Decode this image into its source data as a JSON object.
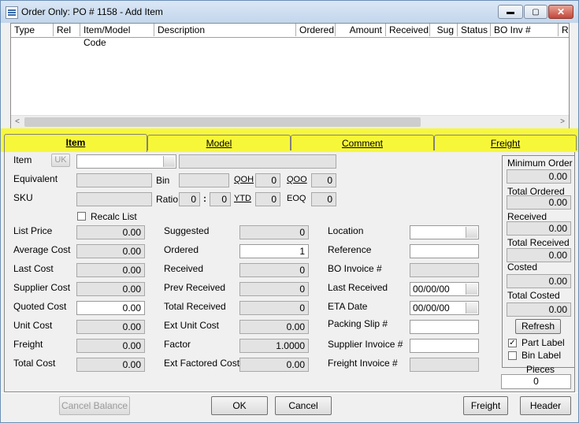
{
  "window": {
    "title": "Order Only: PO # 1158  - Add Item",
    "minimize": "▬",
    "maximize": "▢",
    "close": "✕"
  },
  "grid": {
    "columns": [
      "Type",
      "Rel",
      "Item/Model Code",
      "Description",
      "Ordered",
      "Amount",
      "Received",
      "Sug",
      "Status",
      "BO Inv #",
      "R"
    ],
    "scroll_left": "<",
    "scroll_right": ">"
  },
  "tabs": [
    {
      "label": "Item",
      "active": true
    },
    {
      "label": "Model",
      "active": false
    },
    {
      "label": "Comment",
      "active": false
    },
    {
      "label": "Freight",
      "active": false
    }
  ],
  "top": {
    "item_label": "Item",
    "uk_button": "UK",
    "item_value": "",
    "item_desc": "",
    "equivalent_label": "Equivalent",
    "equivalent_value": "",
    "bin_label": "Bin",
    "bin_value": "",
    "qoh_label": "QOH",
    "qoh_value": "0",
    "qoo_label": "QOO",
    "qoo_value": "0",
    "sku_label": "SKU",
    "sku_value": "",
    "ratio_label": "Ratio",
    "ratio_a": "0",
    "ratio_sep": ":",
    "ratio_b": "0",
    "ytd_label": "YTD",
    "ytd_value": "0",
    "eoq_label": "EOQ",
    "eoq_value": "0",
    "recalc_label": "Recalc List"
  },
  "col1": [
    {
      "label": "List Price",
      "value": "0.00",
      "editable": false
    },
    {
      "label": "Average Cost",
      "value": "0.00",
      "editable": false
    },
    {
      "label": "Last Cost",
      "value": "0.00",
      "editable": false
    },
    {
      "label": "Supplier Cost",
      "value": "0.00",
      "editable": false
    },
    {
      "label": "Quoted Cost",
      "value": "0.00",
      "editable": true
    },
    {
      "label": "Unit Cost",
      "value": "0.00",
      "editable": false
    },
    {
      "label": "Freight",
      "value": "0.00",
      "editable": false
    },
    {
      "label": "Total Cost",
      "value": "0.00",
      "editable": false
    }
  ],
  "col2": [
    {
      "label": "Suggested",
      "value": "0",
      "editable": false
    },
    {
      "label": "Ordered",
      "value": "1",
      "editable": true
    },
    {
      "label": "Received",
      "value": "0",
      "editable": false
    },
    {
      "label": "Prev Received",
      "value": "0",
      "editable": false
    },
    {
      "label": "Total Received",
      "value": "0",
      "editable": false
    },
    {
      "label": "Ext Unit Cost",
      "value": "0.00",
      "editable": false
    },
    {
      "label": "Factor",
      "value": "1.0000",
      "editable": false
    },
    {
      "label": "Ext Factored Cost",
      "value": "0.00",
      "editable": false
    }
  ],
  "col3": [
    {
      "label": "Location",
      "value": "",
      "editable": true,
      "dropdown": true
    },
    {
      "label": "Reference",
      "value": "",
      "editable": true,
      "dropdown": false
    },
    {
      "label": "BO Invoice #",
      "value": "",
      "editable": false,
      "dropdown": false
    },
    {
      "label": "Last Received",
      "value": "00/00/00",
      "editable": true,
      "dropdown": true
    },
    {
      "label": "ETA Date",
      "value": "00/00/00",
      "editable": true,
      "dropdown": true
    },
    {
      "label": "Packing Slip #",
      "value": "",
      "editable": true,
      "dropdown": false
    },
    {
      "label": "Supplier Invoice #",
      "value": "",
      "editable": true,
      "dropdown": false
    },
    {
      "label": "Freight Invoice #",
      "value": "",
      "editable": false,
      "dropdown": false
    }
  ],
  "side": {
    "minimum_order_label": "Minimum Order",
    "minimum_order_value": "0.00",
    "total_ordered_label": "Total Ordered",
    "total_ordered_value": "0.00",
    "received_label": "Received",
    "received_value": "0.00",
    "total_received_label": "Total Received",
    "total_received_value": "0.00",
    "costed_label": "Costed",
    "costed_value": "0.00",
    "total_costed_label": "Total Costed",
    "total_costed_value": "0.00",
    "refresh_button": "Refresh",
    "part_label": "Part Label",
    "part_label_checked": "✓",
    "bin_label": "Bin Label",
    "pieces_label": "Pieces",
    "pieces_value": "0"
  },
  "buttons": {
    "cancel_balance": "Cancel Balance",
    "ok": "OK",
    "cancel": "Cancel",
    "freight": "Freight",
    "header": "Header"
  }
}
